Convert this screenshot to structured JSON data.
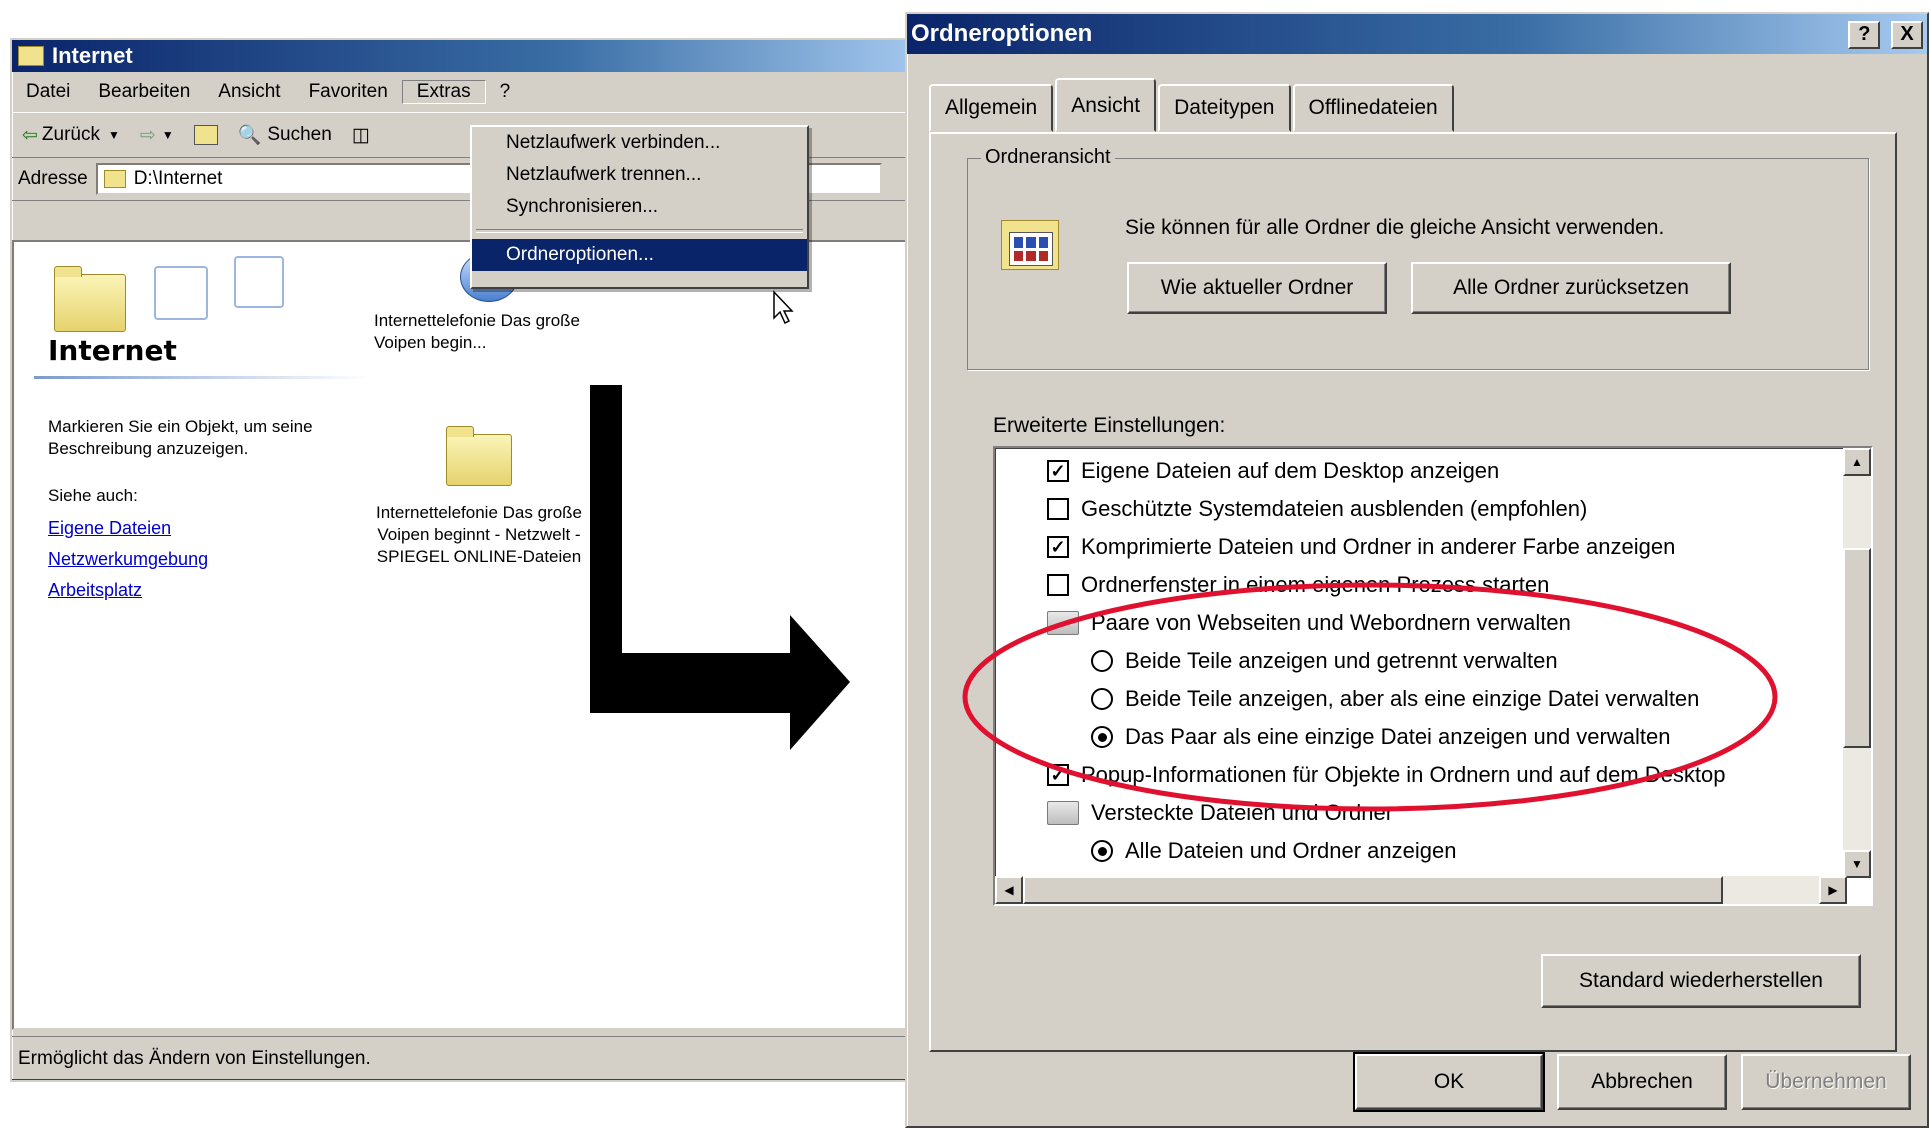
{
  "explorer": {
    "title": "Internet",
    "menu": [
      "Datei",
      "Bearbeiten",
      "Ansicht",
      "Favoriten",
      "Extras",
      "?"
    ],
    "toolbar": {
      "back": "Zurück",
      "search": "Suchen"
    },
    "address_label": "Adresse",
    "address_value": "D:\\Internet",
    "heading": "Internet",
    "description": "Markieren Sie ein Objekt, um seine Beschreibung anzuzeigen.",
    "see_also": "Siehe auch:",
    "links": [
      "Eigene Dateien",
      "Netzwerkumgebung",
      "Arbeitsplatz"
    ],
    "item1": "Internettelefonie Das große Voipen begin...",
    "item2": "Internettelefonie Das große Voipen beginnt - Netzwelt - SPIEGEL ONLINE-Dateien",
    "status": "Ermöglicht das Ändern von Einstellungen."
  },
  "extras_menu": [
    "Netzlaufwerk verbinden...",
    "Netzlaufwerk trennen...",
    "Synchronisieren...",
    "Ordneroptionen..."
  ],
  "dialog": {
    "title": "Ordneroptionen",
    "help_btn": "?",
    "close_btn": "X",
    "tabs": [
      "Allgemein",
      "Ansicht",
      "Dateitypen",
      "Offlinedateien"
    ],
    "folder_view_legend": "Ordneransicht",
    "folder_view_text": "Sie können für alle Ordner die gleiche Ansicht verwenden.",
    "btn_like_current": "Wie aktueller Ordner",
    "btn_reset_all": "Alle Ordner zurücksetzen",
    "advanced_label": "Erweiterte Einstellungen:",
    "settings": [
      {
        "type": "check",
        "checked": true,
        "label": "Eigene Dateien auf dem Desktop anzeigen"
      },
      {
        "type": "check",
        "checked": false,
        "label": "Geschützte Systemdateien ausblenden (empfohlen)"
      },
      {
        "type": "check",
        "checked": true,
        "label": "Komprimierte Dateien und Ordner in anderer Farbe anzeigen"
      },
      {
        "type": "check",
        "checked": false,
        "label": "Ordnerfenster in einem eigenen Prozess starten"
      },
      {
        "type": "folder",
        "label": "Paare von Webseiten und Webordnern verwalten"
      },
      {
        "type": "radio",
        "checked": false,
        "label": "Beide Teile anzeigen und getrennt verwalten"
      },
      {
        "type": "radio",
        "checked": false,
        "label": "Beide Teile anzeigen, aber als eine einzige Datei verwalten"
      },
      {
        "type": "radio",
        "checked": true,
        "label": "Das Paar als eine einzige Datei anzeigen und verwalten"
      },
      {
        "type": "check",
        "checked": true,
        "label": "Popup-Informationen für Objekte in Ordnern und auf dem Desktop"
      },
      {
        "type": "folder",
        "label": "Versteckte Dateien und Ordner"
      },
      {
        "type": "radio",
        "checked": true,
        "label": "Alle Dateien und Ordner anzeigen"
      }
    ],
    "btn_restore": "Standard wiederherstellen",
    "btn_ok": "OK",
    "btn_cancel": "Abbrechen",
    "btn_apply": "Übernehmen"
  },
  "annotation_color": "#e0102f"
}
